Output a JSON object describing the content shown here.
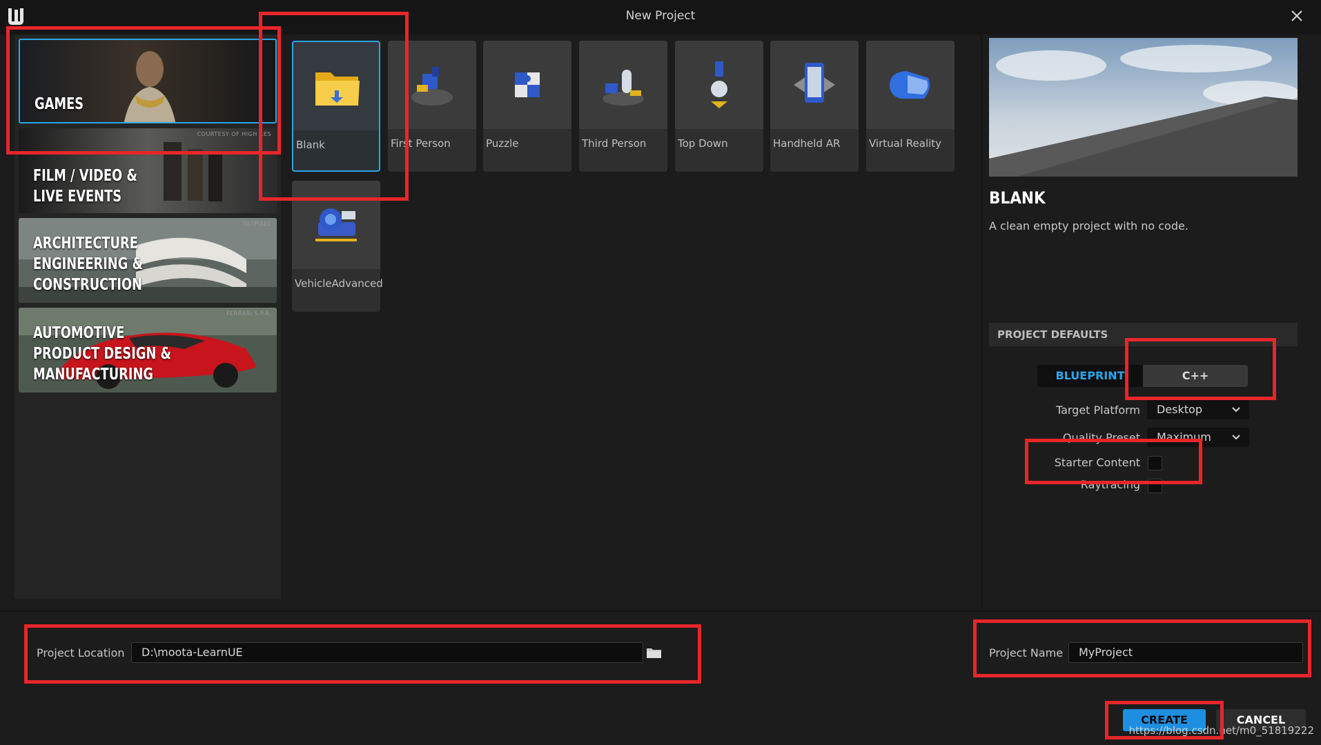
{
  "window": {
    "title": "New Project"
  },
  "categories": [
    {
      "label": "GAMES",
      "credit": ""
    },
    {
      "label": "FILM / VIDEO &\nLIVE EVENTS",
      "credit": "COURTESY OF HIGH RES"
    },
    {
      "label": "ARCHITECTURE\nENGINEERING &\nCONSTRUCTION",
      "credit": "TILTPIXEL"
    },
    {
      "label": "AUTOMOTIVE\nPRODUCT DESIGN &\nMANUFACTURING",
      "credit": "FERRARI S.P.A."
    }
  ],
  "templates": [
    {
      "label": "Blank",
      "icon": "folder-icon"
    },
    {
      "label": "First Person",
      "icon": "first-person-icon"
    },
    {
      "label": "Puzzle",
      "icon": "puzzle-icon"
    },
    {
      "label": "Third Person",
      "icon": "third-person-icon"
    },
    {
      "label": "Top Down",
      "icon": "top-down-icon"
    },
    {
      "label": "Handheld AR",
      "icon": "phone-ar-icon"
    },
    {
      "label": "Virtual Reality",
      "icon": "vr-headset-icon"
    },
    {
      "label": "VehicleAdvanced",
      "icon": "vehicle-icon"
    }
  ],
  "preview": {
    "title": "BLANK",
    "description": "A clean empty project with no code."
  },
  "defaults": {
    "header": "PROJECT DEFAULTS",
    "blueprint_label": "BLUEPRINT",
    "cpp_label": "C++",
    "target_platform_label": "Target Platform",
    "target_platform_value": "Desktop",
    "quality_preset_label": "Quality Preset",
    "quality_preset_value": "Maximum",
    "starter_content_label": "Starter Content",
    "starter_content_checked": false,
    "raytracing_label": "Raytracing",
    "raytracing_checked": false
  },
  "bottom": {
    "location_label": "Project Location",
    "location_value": "D:\\moota-LearnUE",
    "name_label": "Project Name",
    "name_value": "MyProject",
    "create_label": "CREATE",
    "cancel_label": "CANCEL"
  },
  "watermark": "https://blog.csdn.net/m0_51819222",
  "colors": {
    "accent": "#2aa6e8",
    "create_button": "#1e8fe0",
    "annotation": "#e8262a",
    "background": "#1c1c1c"
  }
}
